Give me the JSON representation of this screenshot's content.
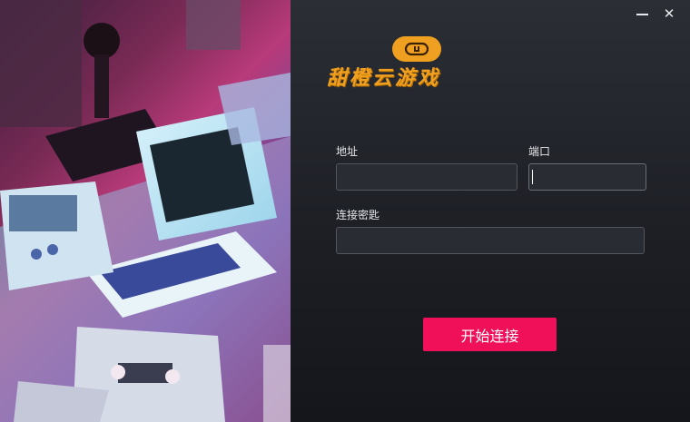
{
  "window": {
    "minimize_icon": "minimize-icon",
    "close_icon": "close-icon",
    "close_glyph": "✕"
  },
  "brand": {
    "name": "甜橙云游戏",
    "logo_icon": "controller-logo-icon",
    "color": "#f0a020"
  },
  "form": {
    "address_label": "地址",
    "address_value": "",
    "port_label": "端口",
    "port_value": "",
    "key_label": "连接密匙",
    "key_value": "",
    "connect_label": "开始连接"
  },
  "colors": {
    "accent": "#f0105a",
    "panel_bg": "#1e2026"
  }
}
